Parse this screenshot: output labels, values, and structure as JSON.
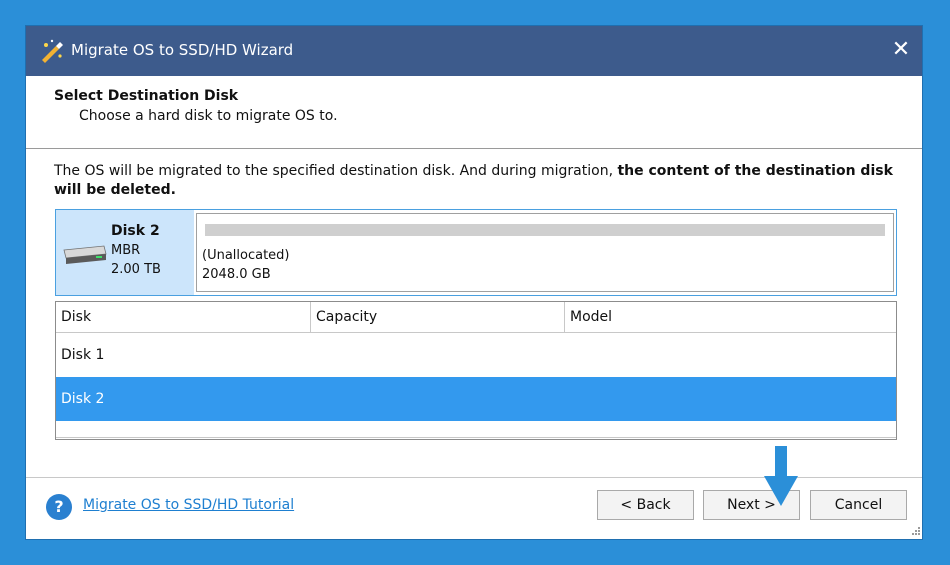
{
  "window": {
    "title": "Migrate OS to SSD/HD Wizard",
    "close_glyph": "✕",
    "icon": "wizard-icon"
  },
  "header": {
    "title": "Select Destination Disk",
    "subtitle": "Choose a hard disk to migrate OS to."
  },
  "notice": {
    "text_normal": "The OS will be migrated to the specified destination disk. And during migration, ",
    "text_bold": "the content of the destination disk will be deleted."
  },
  "selected_disk": {
    "name": "Disk 2",
    "scheme": "MBR",
    "size": "2.00 TB",
    "partition_label": "(Unallocated)",
    "partition_size": "2048.0 GB",
    "icon": "hard-disk-icon"
  },
  "table": {
    "columns": [
      "Disk",
      "Capacity",
      "Model"
    ],
    "rows": [
      {
        "disk": "Disk 1",
        "selected": false
      },
      {
        "disk": "Disk 2",
        "selected": true
      }
    ]
  },
  "footer": {
    "help_glyph": "?",
    "tutorial_link": "Migrate OS to SSD/HD Tutorial",
    "back_label": "< Back",
    "next_label": "Next >",
    "cancel_label": "Cancel"
  },
  "colors": {
    "titlebar": "#3d5b8c",
    "selection": "#3399ee",
    "accent": "#2b8fd8"
  }
}
